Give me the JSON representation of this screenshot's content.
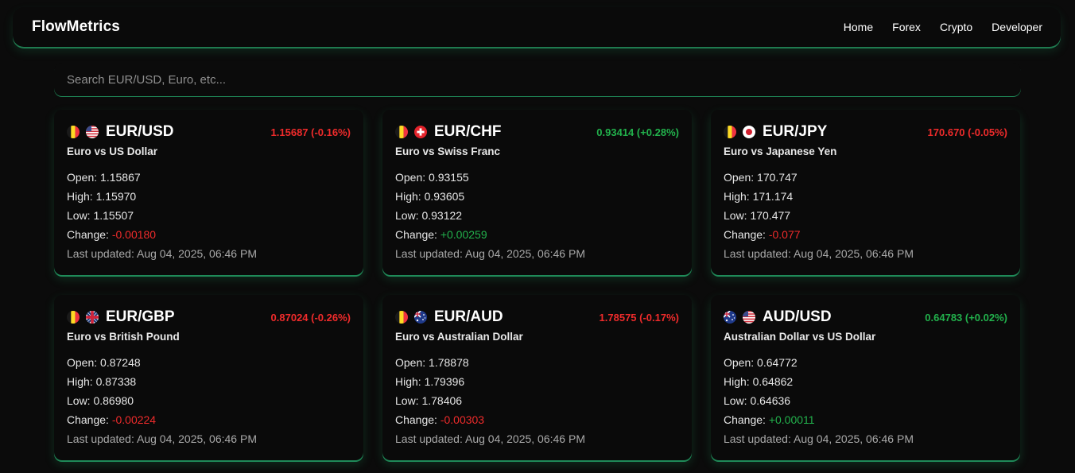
{
  "nav": {
    "brand": "FlowMetrics",
    "links": [
      "Home",
      "Forex",
      "Crypto",
      "Developer"
    ]
  },
  "search": {
    "placeholder": "Search EUR/USD, Euro, etc...",
    "value": ""
  },
  "colors": {
    "negative": "#ef2b2b",
    "positive": "#22b14c",
    "accent_glow": "#1f8a58"
  },
  "labels": {
    "open": "Open:",
    "high": "High:",
    "low": "Low:",
    "change": "Change:",
    "last_updated": "Last updated:"
  },
  "cards": [
    {
      "pair": "EUR/USD",
      "flags": [
        "belgium-flag-icon",
        "us-flag-icon"
      ],
      "description": "Euro vs US Dollar",
      "price": "1.15687 (-0.16%)",
      "direction": "negative",
      "open": "1.15867",
      "high": "1.15970",
      "low": "1.15507",
      "change": "-0.00180",
      "updated": "Aug 04, 2025, 06:46 PM"
    },
    {
      "pair": "EUR/CHF",
      "flags": [
        "belgium-flag-icon",
        "swiss-flag-icon"
      ],
      "description": "Euro vs Swiss Franc",
      "price": "0.93414 (+0.28%)",
      "direction": "positive",
      "open": "0.93155",
      "high": "0.93605",
      "low": "0.93122",
      "change": "+0.00259",
      "updated": "Aug 04, 2025, 06:46 PM"
    },
    {
      "pair": "EUR/JPY",
      "flags": [
        "belgium-flag-icon",
        "japan-flag-icon"
      ],
      "description": "Euro vs Japanese Yen",
      "price": "170.670 (-0.05%)",
      "direction": "negative",
      "open": "170.747",
      "high": "171.174",
      "low": "170.477",
      "change": "-0.077",
      "updated": "Aug 04, 2025, 06:46 PM"
    },
    {
      "pair": "EUR/GBP",
      "flags": [
        "belgium-flag-icon",
        "uk-flag-icon"
      ],
      "description": "Euro vs British Pound",
      "price": "0.87024 (-0.26%)",
      "direction": "negative",
      "open": "0.87248",
      "high": "0.87338",
      "low": "0.86980",
      "change": "-0.00224",
      "updated": "Aug 04, 2025, 06:46 PM"
    },
    {
      "pair": "EUR/AUD",
      "flags": [
        "belgium-flag-icon",
        "australia-flag-icon"
      ],
      "description": "Euro vs Australian Dollar",
      "price": "1.78575 (-0.17%)",
      "direction": "negative",
      "open": "1.78878",
      "high": "1.79396",
      "low": "1.78406",
      "change": "-0.00303",
      "updated": "Aug 04, 2025, 06:46 PM"
    },
    {
      "pair": "AUD/USD",
      "flags": [
        "australia-flag-icon",
        "us-flag-icon"
      ],
      "description": "Australian Dollar vs US Dollar",
      "price": "0.64783 (+0.02%)",
      "direction": "positive",
      "open": "0.64772",
      "high": "0.64862",
      "low": "0.64636",
      "change": "+0.00011",
      "updated": "Aug 04, 2025, 06:46 PM"
    }
  ]
}
